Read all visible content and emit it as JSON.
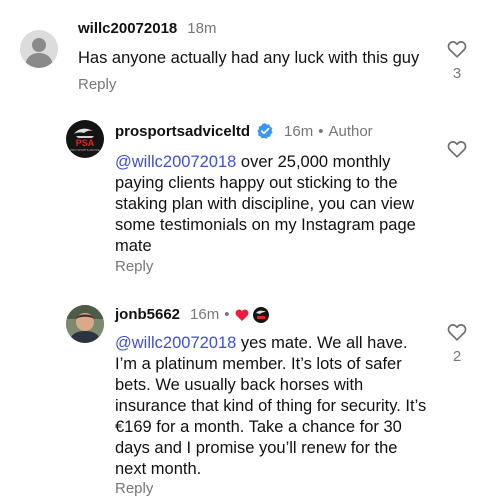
{
  "comments": [
    {
      "username": "willc20072018",
      "time": "18m",
      "text": "Has anyone actually had any luck with this guy",
      "reply_label": "Reply",
      "like_count": "3"
    },
    {
      "username": "prosportsadviceltd",
      "time": "16m",
      "author_label": "Author",
      "mention": "@willc20072018",
      "text": " over 25,000 monthly paying clients happy out sticking to the staking plan with discipline, you can view some testimonials on my Instagram page mate",
      "reply_label": "Reply",
      "avatar_text": "PSA",
      "avatar_subtext": "PRO SPORTS ADVICE"
    },
    {
      "username": "jonb5662",
      "time": "16m",
      "mention": "@willc20072018",
      "text": " yes mate. We all have. I’m a platinum member. It’s lots of safer bets. We usually back horses with insurance that kind of thing for security. It’s €169 for a month. Take a chance for 30 days and I promise you’ll renew for the next month.",
      "reply_label": "Reply",
      "like_count": "2"
    }
  ],
  "colors": {
    "mention": "#3f51c9",
    "verified_badge": "#3897f0",
    "heart": "#ed1c3a",
    "muted_text": "#777777"
  }
}
